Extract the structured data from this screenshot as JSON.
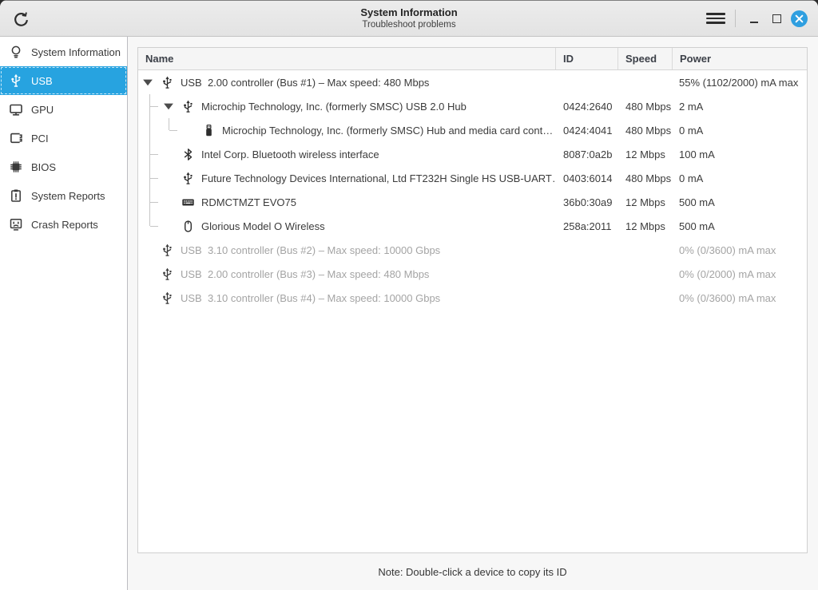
{
  "window": {
    "title": "System Information",
    "subtitle": "Troubleshoot problems"
  },
  "colors": {
    "accent": "#27a3e0",
    "close_button": "#2f9fe0"
  },
  "sidebar": {
    "items": [
      {
        "label": "System Information",
        "icon": "bulb",
        "selected": false
      },
      {
        "label": "USB",
        "icon": "usb",
        "selected": true
      },
      {
        "label": "GPU",
        "icon": "gpu",
        "selected": false
      },
      {
        "label": "PCI",
        "icon": "pci",
        "selected": false
      },
      {
        "label": "BIOS",
        "icon": "bios",
        "selected": false
      },
      {
        "label": "System Reports",
        "icon": "report",
        "selected": false
      },
      {
        "label": "Crash Reports",
        "icon": "crash",
        "selected": false
      }
    ]
  },
  "table": {
    "columns": [
      "Name",
      "ID",
      "Speed",
      "Power"
    ],
    "rows": [
      {
        "depth": 0,
        "expander": true,
        "last": false,
        "dim": false,
        "icon": "usb",
        "name": "USB  2.00 controller (Bus #1) – Max speed: 480 Mbps",
        "id": "",
        "speed": "",
        "power": "55% (1102/2000) mA max"
      },
      {
        "depth": 1,
        "expander": true,
        "last": false,
        "dim": false,
        "icon": "usb",
        "name": "Microchip Technology, Inc. (formerly SMSC) USB 2.0 Hub",
        "id": "0424:2640",
        "speed": "480 Mbps",
        "power": "2 mA"
      },
      {
        "depth": 2,
        "expander": false,
        "last": true,
        "dim": false,
        "icon": "flash-drive",
        "name": "Microchip Technology, Inc. (formerly SMSC) Hub and media card cont…",
        "id": "0424:4041",
        "speed": "480 Mbps",
        "power": "0 mA"
      },
      {
        "depth": 1,
        "expander": false,
        "last": false,
        "dim": false,
        "icon": "bluetooth",
        "name": "Intel Corp. Bluetooth wireless interface",
        "id": "8087:0a2b",
        "speed": "12 Mbps",
        "power": "100 mA"
      },
      {
        "depth": 1,
        "expander": false,
        "last": false,
        "dim": false,
        "icon": "usb",
        "name": "Future Technology Devices International, Ltd FT232H Single HS USB-UART…",
        "id": "0403:6014",
        "speed": "480 Mbps",
        "power": "0 mA"
      },
      {
        "depth": 1,
        "expander": false,
        "last": false,
        "dim": false,
        "icon": "keyboard",
        "name": "RDMCTMZT EVO75",
        "id": "36b0:30a9",
        "speed": "12 Mbps",
        "power": "500 mA"
      },
      {
        "depth": 1,
        "expander": false,
        "last": true,
        "dim": false,
        "icon": "mouse",
        "name": "Glorious Model O Wireless",
        "id": "258a:2011",
        "speed": "12 Mbps",
        "power": "500 mA"
      },
      {
        "depth": 0,
        "expander": false,
        "last": false,
        "dim": true,
        "icon": "usb",
        "name": "USB  3.10 controller (Bus #2) – Max speed: 10000 Gbps",
        "id": "",
        "speed": "",
        "power": "0% (0/3600) mA max"
      },
      {
        "depth": 0,
        "expander": false,
        "last": false,
        "dim": true,
        "icon": "usb",
        "name": "USB  2.00 controller (Bus #3) – Max speed: 480 Mbps",
        "id": "",
        "speed": "",
        "power": "0% (0/2000) mA max"
      },
      {
        "depth": 0,
        "expander": false,
        "last": false,
        "dim": true,
        "icon": "usb",
        "name": "USB  3.10 controller (Bus #4) – Max speed: 10000 Gbps",
        "id": "",
        "speed": "",
        "power": "0% (0/3600) mA max"
      }
    ]
  },
  "note": "Note: Double-click a device to copy its ID"
}
